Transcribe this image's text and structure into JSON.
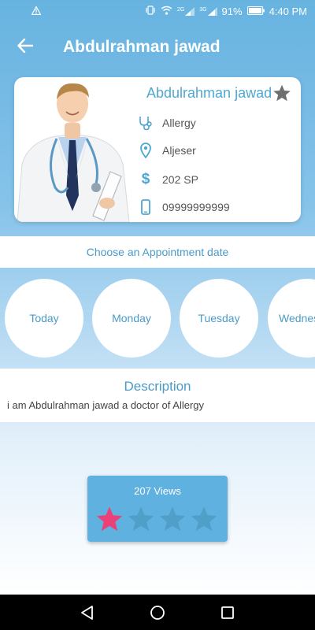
{
  "status_bar": {
    "warning_icon": "warning-triangle-icon",
    "network_2g": "2G",
    "network_3g": "3G",
    "battery": "91%",
    "time": "4:40 PM"
  },
  "app_bar": {
    "title": "Abdulrahman jawad",
    "back_icon": "arrow-left-icon"
  },
  "doctor": {
    "name": "Abdulrahman jawad",
    "specialty": "Allergy",
    "location": "Aljeser",
    "price": "202 SP",
    "phone": "09999999999",
    "favorite_icon": "star-icon"
  },
  "appointment": {
    "prompt": "Choose an Appointment date",
    "days": [
      "Today",
      "Monday",
      "Tuesday",
      "Wednes"
    ]
  },
  "description": {
    "title": "Description",
    "text": "i am Abdulrahman jawad a doctor of Allergy"
  },
  "rating": {
    "views": "207 Views",
    "value": 1,
    "max": 4
  },
  "colors": {
    "accent": "#4ea8d3",
    "star_active": "#ec4078",
    "star_inactive": "#4f9fc9",
    "rating_card": "#5fb1e0"
  }
}
